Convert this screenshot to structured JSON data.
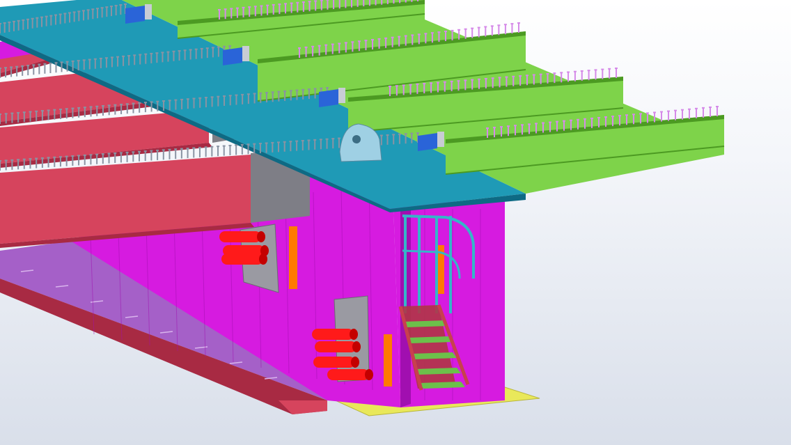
{
  "viewport": {
    "kind": "3d-model-view",
    "background": {
      "top": "#ffffff",
      "bottom": "#d9dfea"
    }
  },
  "colors": {
    "deck_green": "#7ed34a",
    "deck_green_edge": "#4c9a22",
    "deck_teal": "#1f9ab6",
    "deck_teal_edge": "#0e6a84",
    "girder_red": "#d6445d",
    "girder_red_dark": "#a82a43",
    "web_magenta": "#d61be0",
    "web_magenta_dark": "#a10fb0",
    "flange_purple": "#a560c8",
    "grey_plate": "#7e7e86",
    "duct_red": "#ff1a1a",
    "stud_pink": "#d58ae8",
    "stud_grey": "#8a93a3",
    "bracket_blue": "#2a64d8",
    "stair_green": "#6cc04a",
    "stair_frame": "#c8404e",
    "rail_cyan": "#35b6c9",
    "stiffener_orange": "#ff7a00",
    "base_yellow": "#e9e85a"
  },
  "objects": {
    "deck_slab": "deck-slab",
    "cross_beams": "cross-beams",
    "longitudinal_girders": "longitudinal-girders",
    "box_girder": "box-girder",
    "post_tension_ducts": "post-tension-ducts",
    "access_stair": "access-stair",
    "handrail": "handrail",
    "shear_studs": "shear-studs"
  },
  "icons": [
    "shear-stud-icon",
    "bracket-icon",
    "duct-icon",
    "stair-icon"
  ]
}
